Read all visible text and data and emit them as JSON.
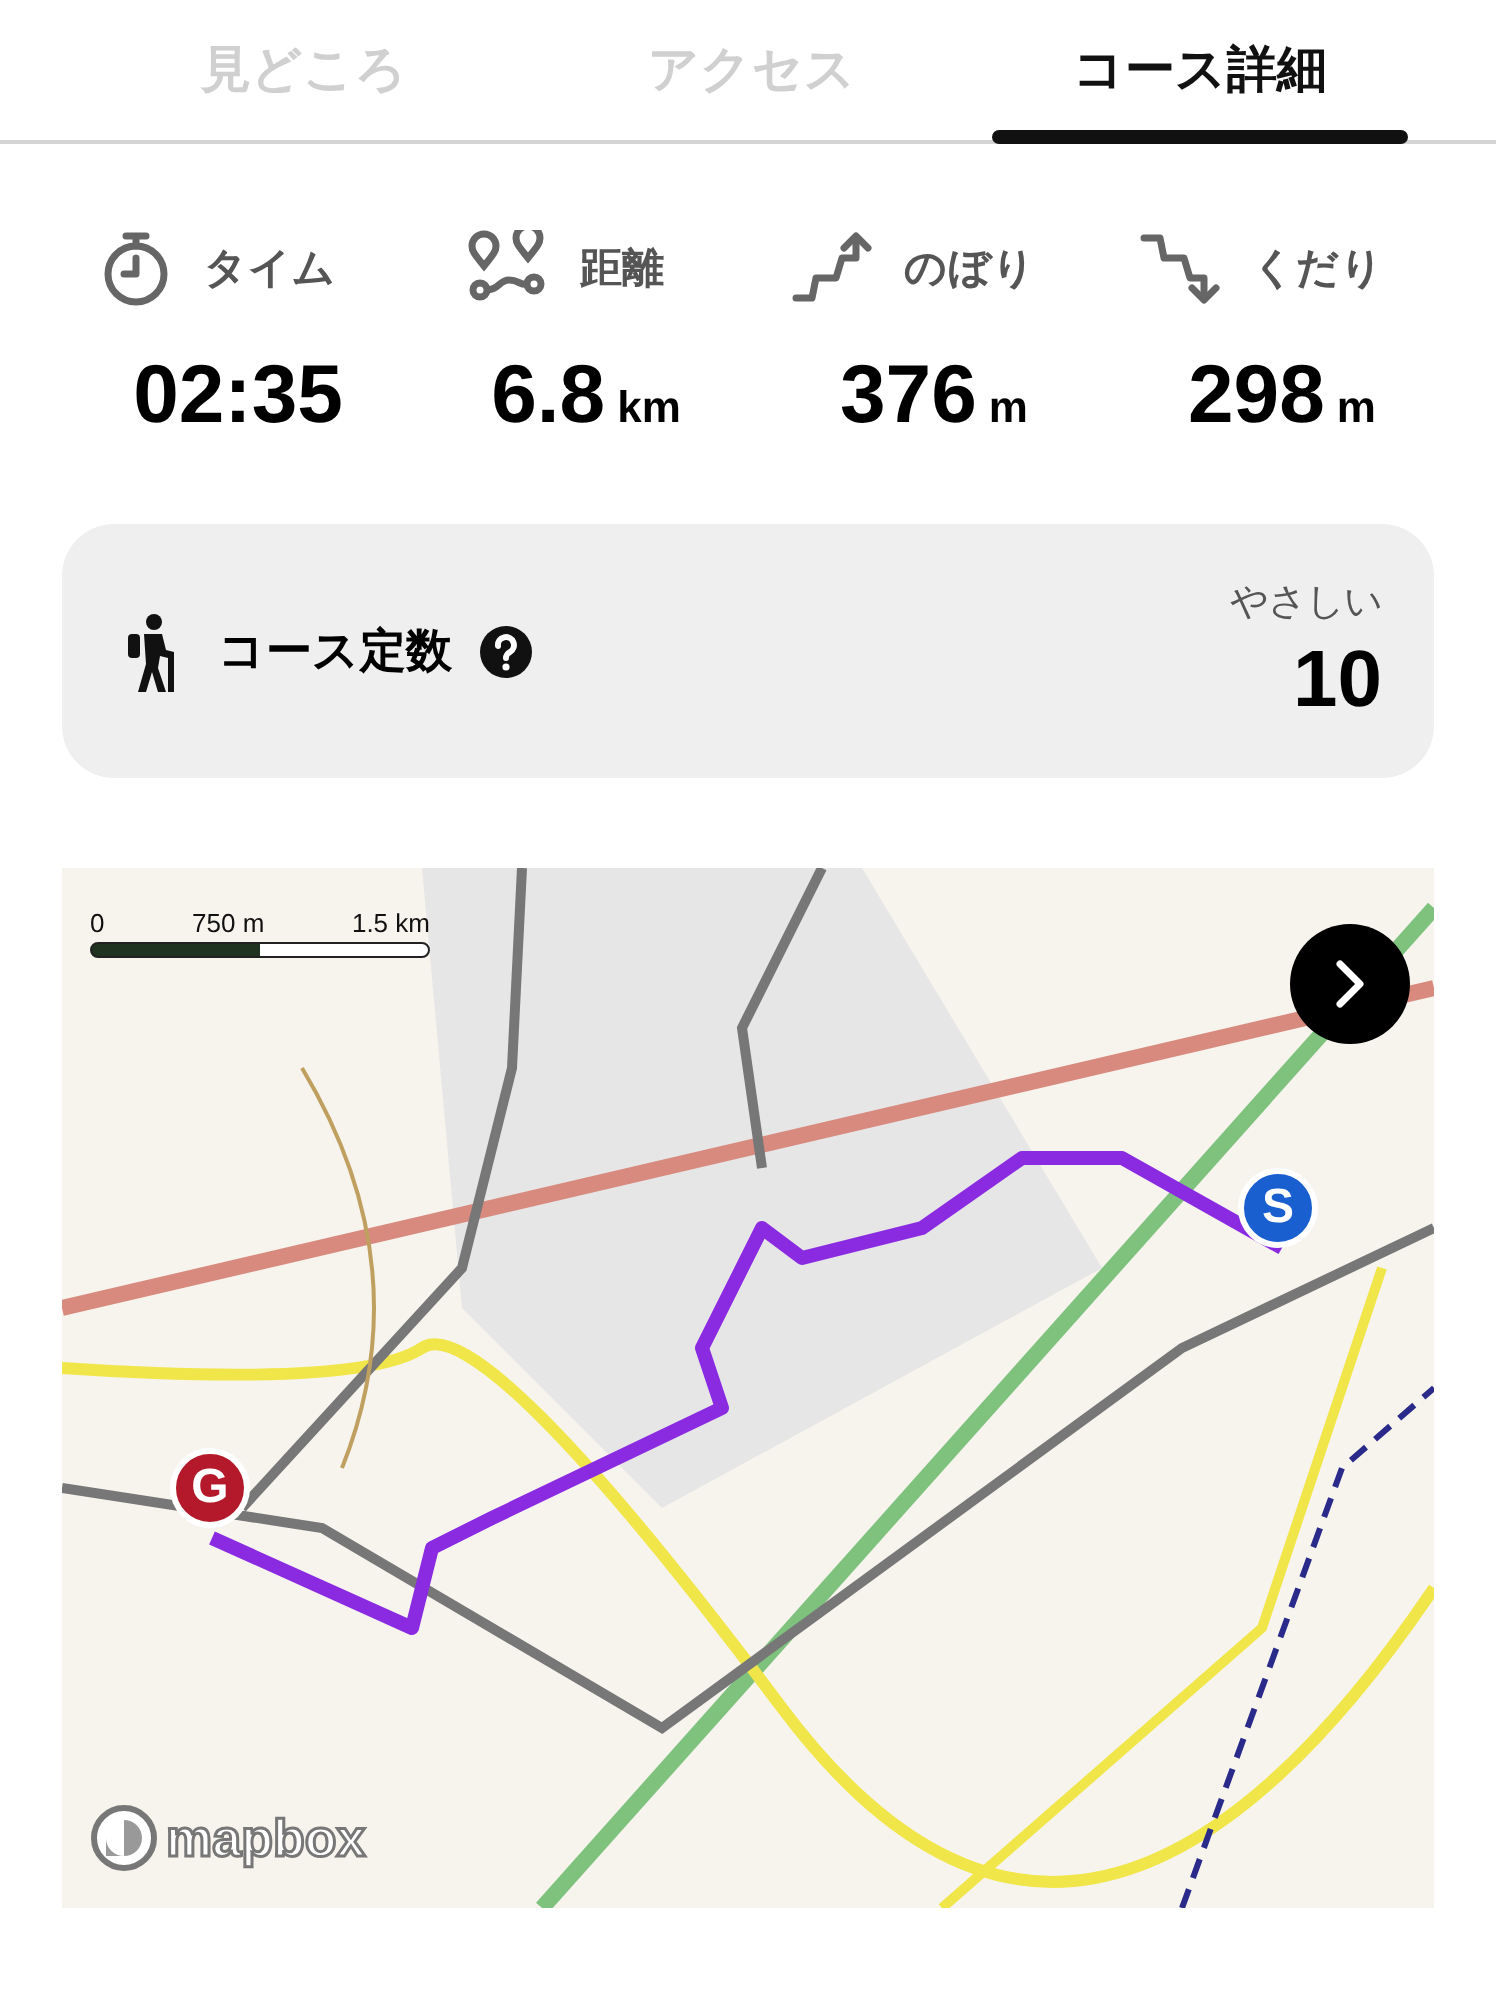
{
  "tabs": [
    {
      "label": "見どころ",
      "selected": false
    },
    {
      "label": "アクセス",
      "selected": false
    },
    {
      "label": "コース詳細",
      "selected": true
    }
  ],
  "stats": [
    {
      "kind": "time",
      "label": "タイム",
      "value": "02:35"
    },
    {
      "kind": "distance",
      "label": "距離",
      "value": "6.8",
      "unit": "km"
    },
    {
      "kind": "ascent",
      "label": "のぼり",
      "value": "376",
      "unit": "m"
    },
    {
      "kind": "descent",
      "label": "くだり",
      "value": "298",
      "unit": "m"
    }
  ],
  "course_constant": {
    "label": "コース定数",
    "difficulty": "やさしい",
    "value": "10"
  },
  "map": {
    "scale_labels": [
      "0",
      "750 m",
      "1.5 km"
    ],
    "markers": [
      {
        "kind": "start",
        "letter": "S"
      },
      {
        "kind": "goal",
        "letter": "G"
      }
    ],
    "attribution": "mapbox"
  }
}
